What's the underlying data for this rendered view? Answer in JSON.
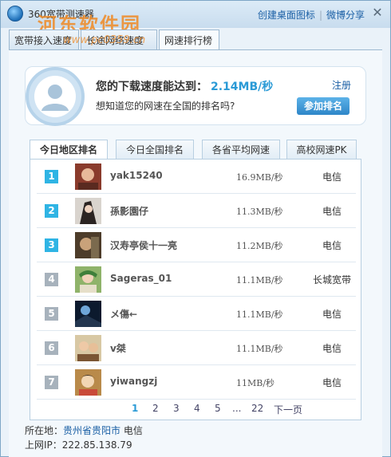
{
  "window": {
    "title": "360宽带测速器",
    "watermark_title": "河东软件园",
    "watermark_url": "www.pc0359.cn",
    "top_links": [
      "创建桌面图标",
      "微博分享"
    ]
  },
  "main_tabs": [
    "宽带接入速度",
    "长途网络速度",
    "网速排行榜"
  ],
  "speed_card": {
    "label": "您的下载速度能达到：",
    "value": "2.14MB/秒",
    "question": "想知道您的网速在全国的排名吗?",
    "register": "注册",
    "join_button": "参加排名"
  },
  "rank_tabs": [
    "今日地区排名",
    "今日全国排名",
    "各省平均网速",
    "高校网速PK"
  ],
  "rankings": [
    {
      "rank": "1",
      "name": "yak15240",
      "speed": "16.9MB/秒",
      "isp": "电信",
      "badge_color": "#2fb4e4"
    },
    {
      "rank": "2",
      "name": "孫影園仔",
      "speed": "11.3MB/秒",
      "isp": "电信",
      "badge_color": "#2fb4e4"
    },
    {
      "rank": "3",
      "name": "汉寿亭侯十一亮",
      "speed": "11.2MB/秒",
      "isp": "电信",
      "badge_color": "#2fb4e4"
    },
    {
      "rank": "4",
      "name": "Sageras_01",
      "speed": "11.1MB/秒",
      "isp": "长城宽带",
      "badge_color": "#a7b2bc"
    },
    {
      "rank": "5",
      "name": "メ傷←",
      "speed": "11.1MB/秒",
      "isp": "电信",
      "badge_color": "#a7b2bc"
    },
    {
      "rank": "6",
      "name": "v桀",
      "speed": "11.1MB/秒",
      "isp": "电信",
      "badge_color": "#a7b2bc"
    },
    {
      "rank": "7",
      "name": "yiwangzj",
      "speed": "11MB/秒",
      "isp": "电信",
      "badge_color": "#a7b2bc"
    }
  ],
  "pager": {
    "pages": [
      "1",
      "2",
      "3",
      "4",
      "5",
      "...",
      "22"
    ],
    "next": "下一页",
    "current": "1"
  },
  "footer": {
    "location_label": "所在地：",
    "location": "贵州省贵阳市",
    "isp": "电信",
    "ip_label": "上网IP：",
    "ip": "222.85.138.79"
  }
}
